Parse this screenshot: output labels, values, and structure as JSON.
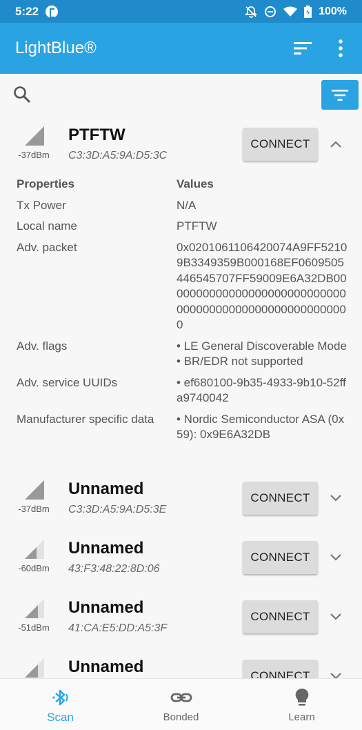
{
  "status_bar": {
    "time": "5:22",
    "battery": "100%"
  },
  "app_bar": {
    "title": "LightBlue®"
  },
  "colors": {
    "primary": "#2aa3e3",
    "status": "#1f8bcb"
  },
  "devices": [
    {
      "name": "PTFTW",
      "address": "C3:3D:A5:9A:D5:3C",
      "rssi": "-37dBm",
      "connect_label": "CONNECT",
      "expanded": true
    },
    {
      "name": "Unnamed",
      "address": "C3:3D:A5:9A:D5:3E",
      "rssi": "-37dBm",
      "connect_label": "CONNECT",
      "expanded": false
    },
    {
      "name": "Unnamed",
      "address": "43:F3:48:22:8D:06",
      "rssi": "-60dBm",
      "connect_label": "CONNECT",
      "expanded": false
    },
    {
      "name": "Unnamed",
      "address": "41:CA:E5:DD:A5:3F",
      "rssi": "-51dBm",
      "connect_label": "CONNECT",
      "expanded": false
    },
    {
      "name": "Unnamed",
      "connect_label": "CONNECT",
      "expanded": false
    }
  ],
  "properties": {
    "header_key": "Properties",
    "header_value": "Values",
    "rows": [
      {
        "key": "Tx Power",
        "value": "N/A"
      },
      {
        "key": "Local name",
        "value": "PTFTW"
      },
      {
        "key": "Adv. packet",
        "value": "0x0201061106420074A9FF52109B3349359B000168EF0609505446545707FF59009E6A32DB0000000000000000000000000000000000000000000000000000000"
      },
      {
        "key": "Adv. flags",
        "values": [
          "• LE General Discoverable Mode",
          "• BR/EDR not supported"
        ]
      },
      {
        "key": "Adv. service UUIDs",
        "values": [
          "• ef680100-9b35-4933-9b10-52ffa9740042"
        ]
      },
      {
        "key": "Manufacturer specific data",
        "values": [
          "• Nordic Semiconductor ASA (0x59): 0x9E6A32DB"
        ]
      }
    ]
  },
  "bottom_nav": {
    "scan": "Scan",
    "bonded": "Bonded",
    "learn": "Learn"
  }
}
